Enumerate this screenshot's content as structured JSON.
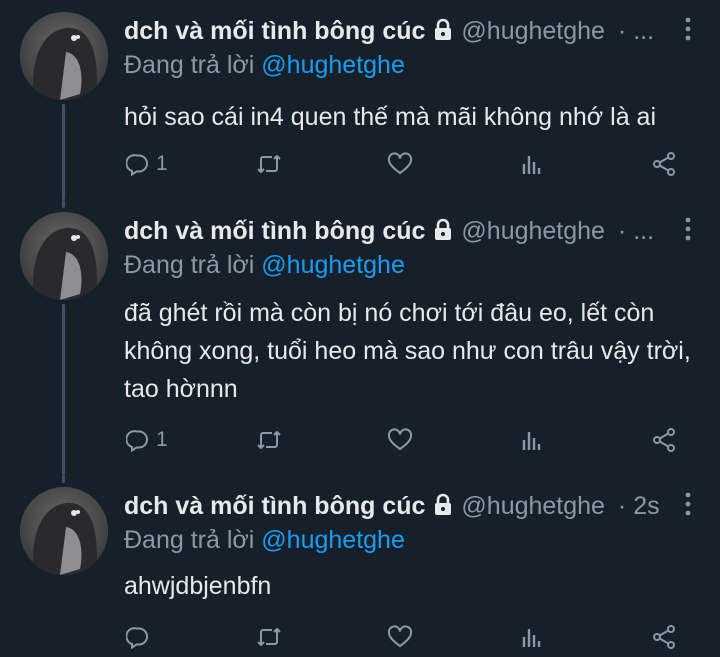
{
  "tweets": [
    {
      "author_name": "dch và mối tình bông cúc",
      "handle": "@hughetghe",
      "time": "· ...",
      "replying_label": "Đang trả lời",
      "replying_to": "@hughetghe",
      "text": "hỏi sao cái in4 quen thế mà mãi không nhớ là ai",
      "reply_count": "1"
    },
    {
      "author_name": "dch và mối tình bông cúc",
      "handle": "@hughetghe",
      "time": "· ...",
      "replying_label": "Đang trả lời",
      "replying_to": "@hughetghe",
      "text": "đã ghét rồi mà còn bị nó chơi tới đâu eo, lết còn không xong, tuổi heo mà sao như con trâu vậy trời, tao hờnnn",
      "reply_count": "1"
    },
    {
      "author_name": "dch và mối tình bông cúc",
      "handle": "@hughetghe",
      "time": "· 2s",
      "replying_label": "Đang trả lời",
      "replying_to": "@hughetghe",
      "text": "ahwjdbjenbfn",
      "reply_count": ""
    }
  ],
  "icons": [
    "lock-icon",
    "more-icon",
    "reply-icon",
    "retweet-icon",
    "like-icon",
    "analytics-icon",
    "share-icon"
  ],
  "colors": {
    "background": "#15202b",
    "text": "#e7e9ea",
    "muted": "#8b98a5",
    "accent": "#1d9bf0",
    "thread_line": "#3d5466"
  }
}
